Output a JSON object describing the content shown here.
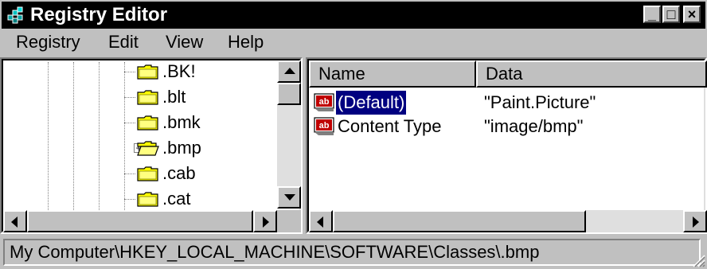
{
  "window": {
    "title": "Registry Editor",
    "controls": {
      "minimize": "_",
      "maximize": "□",
      "close": "×"
    }
  },
  "menu": [
    {
      "label": "Registry"
    },
    {
      "label": "Edit"
    },
    {
      "label": "View"
    },
    {
      "label": "Help"
    }
  ],
  "tree": {
    "items": [
      {
        "label": ".BK!",
        "icon": "folder-icon"
      },
      {
        "label": ".blt",
        "icon": "folder-icon"
      },
      {
        "label": ".bmk",
        "icon": "folder-icon"
      },
      {
        "label": ".bmp",
        "icon": "open-folder-icon",
        "expander": "+"
      },
      {
        "label": ".cab",
        "icon": "folder-icon"
      },
      {
        "label": ".cat",
        "icon": "folder-icon"
      }
    ]
  },
  "list": {
    "columns": [
      {
        "label": "Name"
      },
      {
        "label": "Data"
      }
    ],
    "rows": [
      {
        "name": "(Default)",
        "data": "\"Paint.Picture\"",
        "icon": "string-value-icon",
        "selected": true
      },
      {
        "name": "Content Type",
        "data": "\"image/bmp\"",
        "icon": "string-value-icon",
        "selected": false
      }
    ]
  },
  "status": {
    "path": "My Computer\\HKEY_LOCAL_MACHINE\\SOFTWARE\\Classes\\.bmp"
  },
  "colors": {
    "title_bar": "#000000",
    "face": "#c0c0c0",
    "selection": "#000080",
    "folder": "#ffff00"
  }
}
